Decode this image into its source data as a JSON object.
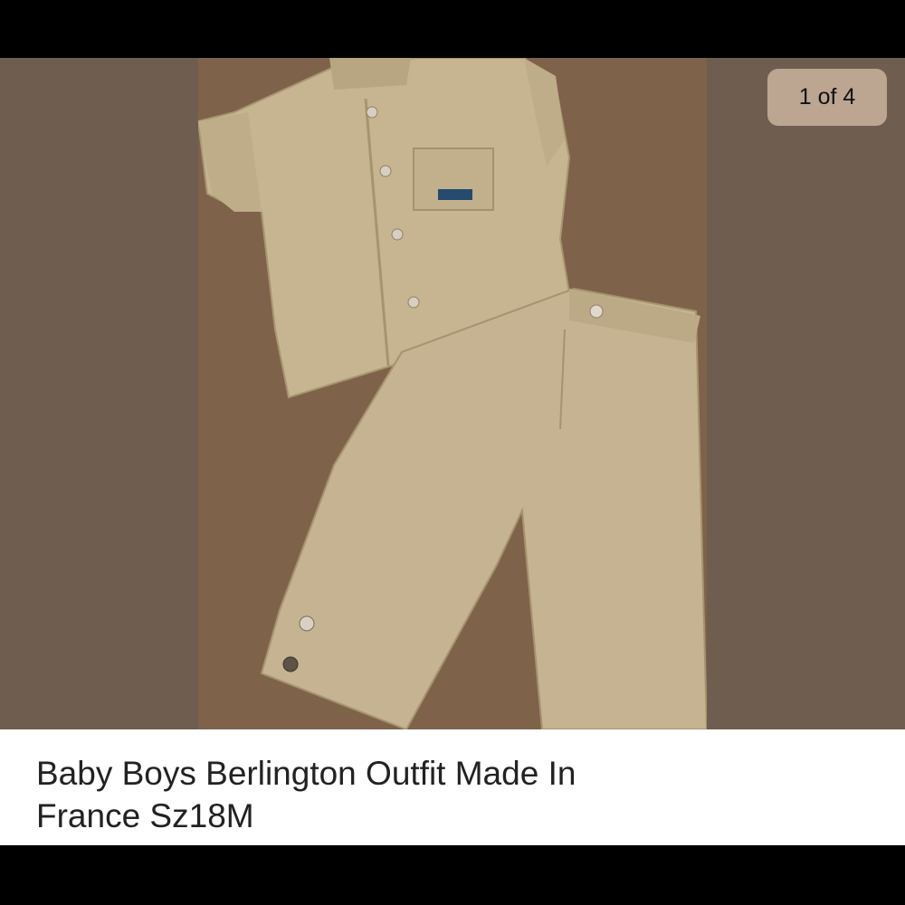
{
  "gallery": {
    "counter": "1 of 4",
    "photo_subject": "Baby boys linen shirt and trousers laid on a brown sofa"
  },
  "listing": {
    "title": "Baby Boys Berlington Outfit Made In France Sz18M"
  },
  "colors": {
    "background": "#6f5e50",
    "counter_badge": "#bca692",
    "caption_bg": "#ffffff",
    "caption_text": "#222222"
  }
}
